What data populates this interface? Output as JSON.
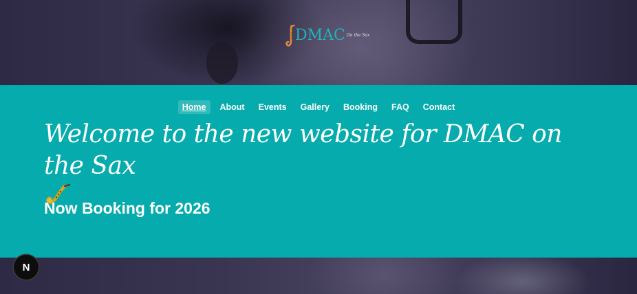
{
  "header": {
    "logo_text": "DMAC",
    "logo_subtext": "On the Sax"
  },
  "nav": {
    "items": [
      {
        "label": "Home",
        "active": true
      },
      {
        "label": "About"
      },
      {
        "label": "Events"
      },
      {
        "label": "Gallery"
      },
      {
        "label": "Booking"
      },
      {
        "label": "FAQ"
      },
      {
        "label": "Contact"
      }
    ]
  },
  "hero": {
    "headline": "Welcome to the new website for DMAC on the Sax",
    "subheadline": "Now Booking for 2026"
  },
  "dev_badge": {
    "letter": "N"
  },
  "colors": {
    "band": "#05abad",
    "logo_teal": "#1fb3b8",
    "logo_sax": "#e08a3c"
  },
  "icons": [
    "saxophone-icon",
    "saxophone-emoji-icon",
    "next-dev-badge-icon"
  ]
}
